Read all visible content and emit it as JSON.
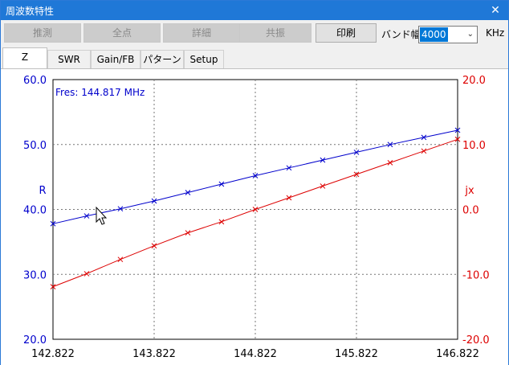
{
  "window": {
    "title": "周波数特性",
    "close": "✕"
  },
  "toolbar": {
    "buttons": [
      {
        "label": "推測",
        "enabled": false
      },
      {
        "label": "全点",
        "enabled": false
      },
      {
        "label": "詳細",
        "enabled": false
      },
      {
        "label": "共振",
        "enabled": false
      },
      {
        "label": "印刷",
        "enabled": true
      }
    ],
    "band_label": "バンド幅",
    "band_value": "4000",
    "unit": "KHz"
  },
  "tabs": [
    {
      "label": "Z",
      "active": true
    },
    {
      "label": "SWR",
      "active": false
    },
    {
      "label": "Gain/FB",
      "active": false
    },
    {
      "label": "パターン",
      "active": false
    },
    {
      "label": "Setup",
      "active": false
    }
  ],
  "chart_data": {
    "type": "line",
    "annotation": "Fres: 144.817 MHz",
    "xlabel": "",
    "ylabel_left": "R",
    "ylabel_right": "jx",
    "x_ticks": [
      "142.822",
      "143.822",
      "144.822",
      "145.822",
      "146.822"
    ],
    "xlim": [
      142.822,
      146.822
    ],
    "y_left_ticks": [
      "60.0",
      "50.0",
      "40.0",
      "30.0",
      "20.0"
    ],
    "ylim_left": [
      20,
      60
    ],
    "y_right_ticks": [
      "20.0",
      "10.0",
      "0.0",
      "-10.0",
      "-20.0"
    ],
    "ylim_right": [
      -20,
      20
    ],
    "grid": true,
    "colors": {
      "left": "#0000cc",
      "right": "#dd0000"
    },
    "series": [
      {
        "axis": "left",
        "color": "#0000cc",
        "x": [
          142.822,
          143.155,
          143.488,
          143.822,
          144.155,
          144.488,
          144.822,
          145.155,
          145.488,
          145.822,
          146.155,
          146.488,
          146.822
        ],
        "values": [
          37.8,
          39.0,
          40.1,
          41.3,
          42.6,
          43.9,
          45.2,
          46.4,
          47.6,
          48.8,
          50.0,
          51.1,
          52.2
        ]
      },
      {
        "axis": "right",
        "color": "#dd0000",
        "x": [
          142.822,
          143.155,
          143.488,
          143.822,
          144.155,
          144.488,
          144.822,
          145.155,
          145.488,
          145.822,
          146.155,
          146.488,
          146.822
        ],
        "values": [
          -11.9,
          -9.9,
          -7.7,
          -5.6,
          -3.6,
          -1.9,
          0.0,
          1.8,
          3.6,
          5.4,
          7.2,
          9.0,
          10.8
        ]
      }
    ]
  }
}
